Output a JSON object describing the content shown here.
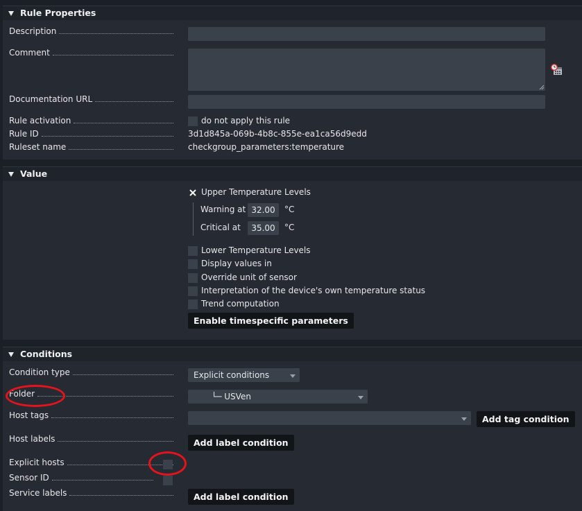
{
  "rule_properties": {
    "title": "Rule Properties",
    "description_label": "Description",
    "comment_label": "Comment",
    "doc_url_label": "Documentation URL",
    "activation_label": "Rule activation",
    "activation_option": "do not apply this rule",
    "rule_id_label": "Rule ID",
    "rule_id_value": "3d1d845a-069b-4b8c-855e-ea1ca56d9edd",
    "ruleset_label": "Ruleset name",
    "ruleset_value": "checkgroup_parameters:temperature",
    "timestamp_icon": "calendar-clock-icon"
  },
  "value": {
    "title": "Value",
    "upper_levels": {
      "label": "Upper Temperature Levels",
      "checked": true,
      "warning_label": "Warning at",
      "warning_value": "32.00",
      "critical_label": "Critical at",
      "critical_value": "35.00",
      "unit": "°C"
    },
    "options": [
      "Lower Temperature Levels",
      "Display values in",
      "Override unit of sensor",
      "Interpretation of the device's own temperature status",
      "Trend computation"
    ],
    "timespecific_button": "Enable timespecific parameters"
  },
  "conditions": {
    "title": "Conditions",
    "condition_type_label": "Condition type",
    "condition_type_value": "Explicit conditions",
    "folder_label": "Folder",
    "folder_value": "└─ USVen",
    "host_tags_label": "Host tags",
    "add_tag_button": "Add tag condition",
    "host_labels_label": "Host labels",
    "add_label_button": "Add label condition",
    "explicit_hosts_label": "Explicit hosts",
    "sensor_id_label": "Sensor ID",
    "service_labels_label": "Service labels",
    "add_service_label_button": "Add label condition"
  },
  "colors": {
    "annotation_red": "#e5131b",
    "panel_bg": "#262b33",
    "input_bg": "#3a414b"
  }
}
